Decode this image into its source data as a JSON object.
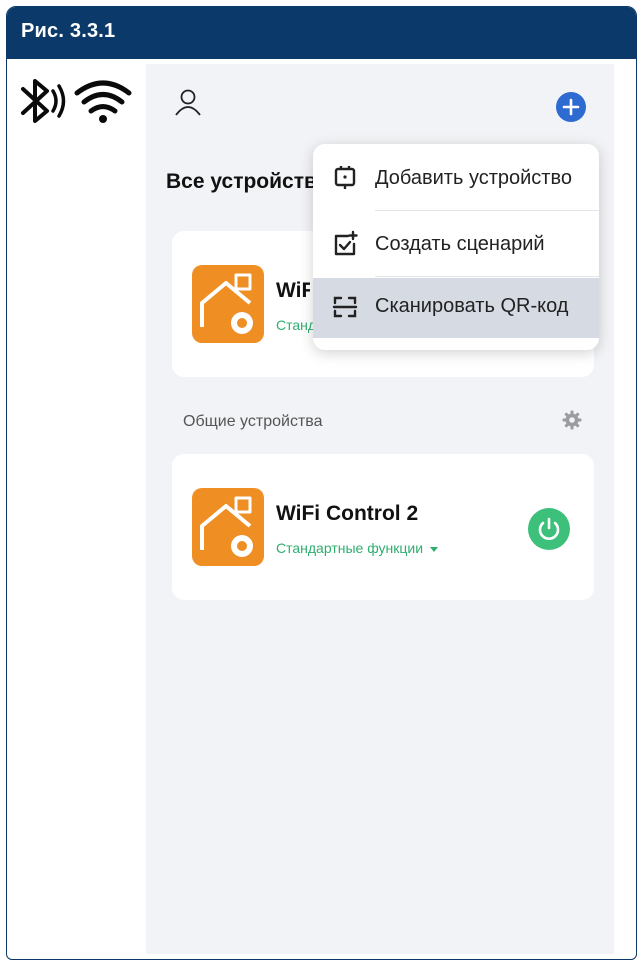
{
  "figure": {
    "title": "Рис. 3.3.1"
  },
  "colors": {
    "header_bg": "#0b3a6a",
    "accent_blue": "#2e6bd1",
    "device_orange": "#ee8e23",
    "status_green": "#2fae6f",
    "power_green": "#3cc07a",
    "menu_selected": "#d6dae3"
  },
  "status_icons": {
    "bluetooth": "bluetooth-icon",
    "wifi": "wifi-icon"
  },
  "header": {
    "section_title": "Все устройства"
  },
  "menu": {
    "items": [
      {
        "label": "Добавить устройство",
        "icon": "add-device-icon"
      },
      {
        "label": "Создать сценарий",
        "icon": "create-scene-icon"
      },
      {
        "label": "Сканировать QR-код",
        "icon": "scan-qr-icon",
        "selected": true
      }
    ]
  },
  "devices": [
    {
      "name": "WiFi",
      "subtitle": "Стандартные функции"
    }
  ],
  "shared": {
    "label": "Общие устройства",
    "devices": [
      {
        "name": "WiFi Control 2",
        "subtitle": "Стандартные функции"
      }
    ]
  }
}
